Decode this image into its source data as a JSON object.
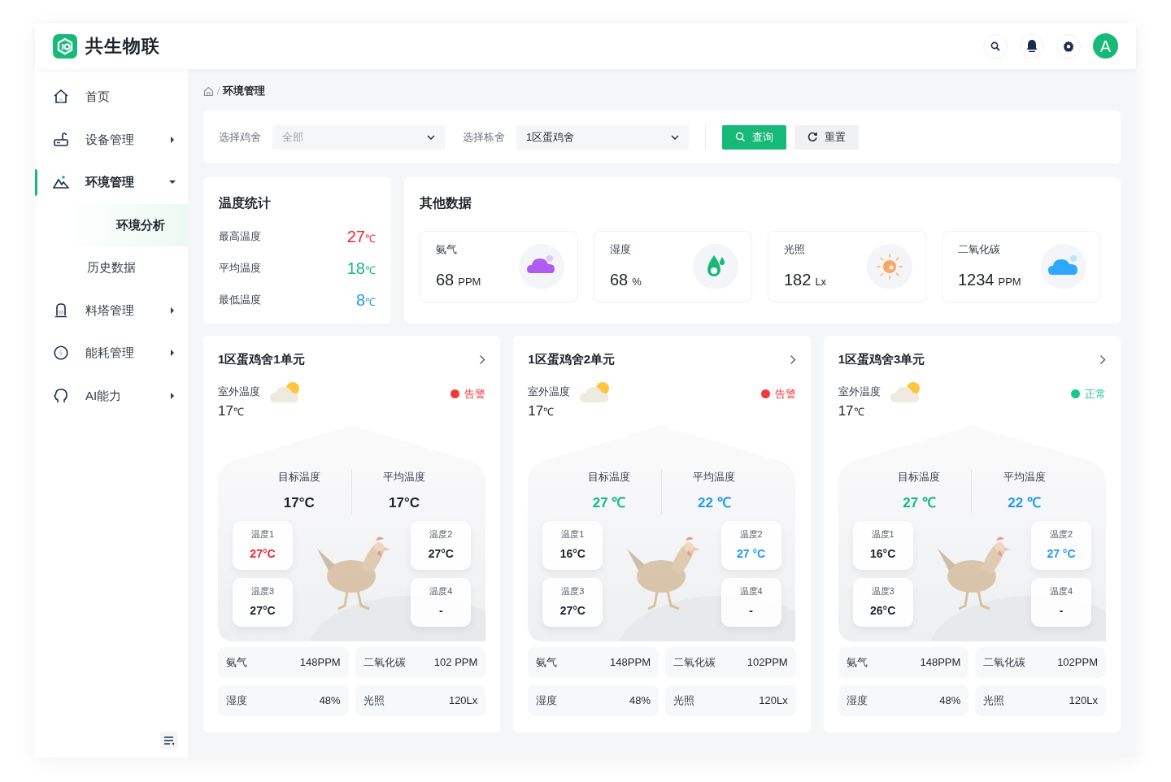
{
  "brand": {
    "name": "共生物联"
  },
  "header": {
    "avatar": "A"
  },
  "sidebar": {
    "items": [
      {
        "label": "首页",
        "selected": false
      },
      {
        "label": "设备管理",
        "selected": false,
        "expanded": false
      },
      {
        "label": "环境管理",
        "selected": true,
        "expanded": true,
        "children": [
          {
            "label": "环境分析",
            "selected": true
          },
          {
            "label": "历史数据",
            "selected": false
          }
        ]
      },
      {
        "label": "料塔管理",
        "selected": false,
        "expanded": false
      },
      {
        "label": "能耗管理",
        "selected": false,
        "expanded": false
      },
      {
        "label": "AI能力",
        "selected": false,
        "expanded": false
      }
    ]
  },
  "breadcrumb": {
    "separator": "/",
    "items": [
      "环境管理"
    ]
  },
  "filters": [
    {
      "label": "选择鸡舍",
      "placeholder": "全部"
    },
    {
      "label": "选择栋舍",
      "value": "1区蛋鸡舍"
    }
  ],
  "buttons": [
    {
      "label": "查询",
      "kind": "primary"
    },
    {
      "label": "重置",
      "kind": "default"
    }
  ],
  "temperature_stats": {
    "title": "温度统计",
    "rows": [
      {
        "label": "最高温度",
        "value": "27",
        "unit": "℃",
        "color": "#f5222d"
      },
      {
        "label": "平均温度",
        "value": "18",
        "unit": "℃",
        "color": "#12b886"
      },
      {
        "label": "最低温度",
        "value": "8",
        "unit": "℃",
        "color": "#1e9bf0"
      }
    ]
  },
  "other_data": {
    "title": "其他数据",
    "metrics": [
      {
        "label": "氨气",
        "value": "68",
        "unit": "PPM"
      },
      {
        "label": "湿度",
        "value": "68",
        "unit": "%"
      },
      {
        "label": "光照",
        "value": "182",
        "unit": "Lx"
      },
      {
        "label": "二氧化碳",
        "value": "1234",
        "unit": "PPM"
      }
    ]
  },
  "units": [
    {
      "title": "1区蛋鸡舍1单元",
      "outdoor_label": "室外温度",
      "outdoor_value": "17",
      "outdoor_unit": "℃",
      "status": {
        "label": "告警",
        "kind": "alarm"
      },
      "target": {
        "label": "目标温度",
        "value": "17°C",
        "color": "#1f2329"
      },
      "average": {
        "label": "平均温度",
        "value": "17°C",
        "color": "#1f2329"
      },
      "sensors": [
        {
          "label": "温度1",
          "value": "27°C",
          "color": "#f5222d"
        },
        {
          "label": "温度2",
          "value": "27°C",
          "color": "#1f2329"
        },
        {
          "label": "温度3",
          "value": "27°C",
          "color": "#1f2329"
        },
        {
          "label": "温度4",
          "value": "-"
        }
      ],
      "readings": [
        {
          "label": "氨气",
          "value": "148PPM"
        },
        {
          "label": "二氧化碳",
          "value": "102 PPM"
        },
        {
          "label": "湿度",
          "value": "48%"
        },
        {
          "label": "光照",
          "value": "120Lx"
        }
      ]
    },
    {
      "title": "1区蛋鸡舍2单元",
      "outdoor_label": "室外温度",
      "outdoor_value": "17",
      "outdoor_unit": "℃",
      "status": {
        "label": "告警",
        "kind": "alarm"
      },
      "target": {
        "label": "目标温度",
        "value": "27 ℃",
        "color": "#12b886"
      },
      "average": {
        "label": "平均温度",
        "value": "22 ℃",
        "color": "#1e9bf0"
      },
      "sensors": [
        {
          "label": "温度1",
          "value": "16°C",
          "color": "#1f2329"
        },
        {
          "label": "温度2",
          "value": "27 °C",
          "color": "#1e9bf0"
        },
        {
          "label": "温度3",
          "value": "27°C",
          "color": "#1f2329"
        },
        {
          "label": "温度4",
          "value": "-"
        }
      ],
      "readings": [
        {
          "label": "氨气",
          "value": "148PPM"
        },
        {
          "label": "二氧化碳",
          "value": "102PPM"
        },
        {
          "label": "湿度",
          "value": "48%"
        },
        {
          "label": "光照",
          "value": "120Lx"
        }
      ]
    },
    {
      "title": "1区蛋鸡舍3单元",
      "outdoor_label": "室外温度",
      "outdoor_value": "17",
      "outdoor_unit": "℃",
      "status": {
        "label": "正常",
        "kind": "normal"
      },
      "target": {
        "label": "目标温度",
        "value": "27 ℃",
        "color": "#12b886"
      },
      "average": {
        "label": "平均温度",
        "value": "22 ℃",
        "color": "#1e9bf0"
      },
      "sensors": [
        {
          "label": "温度1",
          "value": "16°C",
          "color": "#1f2329"
        },
        {
          "label": "温度2",
          "value": "27 °C",
          "color": "#1e9bf0"
        },
        {
          "label": "温度3",
          "value": "26°C",
          "color": "#1f2329"
        },
        {
          "label": "温度4",
          "value": "-"
        }
      ],
      "readings": [
        {
          "label": "氨气",
          "value": "148PPM"
        },
        {
          "label": "二氧化碳",
          "value": "102PPM"
        },
        {
          "label": "湿度",
          "value": "48%"
        },
        {
          "label": "光照",
          "value": "120Lx"
        }
      ]
    }
  ]
}
